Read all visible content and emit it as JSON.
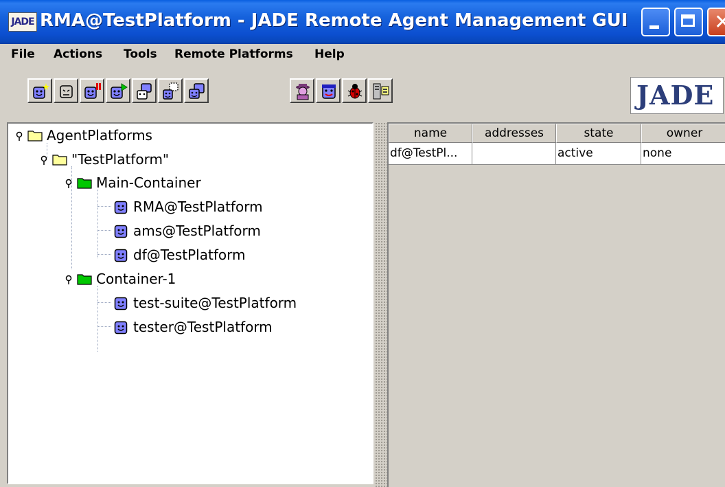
{
  "window": {
    "title": "RMA@TestPlatform - JADE Remote Agent Management GUI",
    "app_icon_text": "JADE",
    "controls": [
      "minimize-icon",
      "maximize-icon",
      "close-icon"
    ]
  },
  "menu": {
    "file": "File",
    "actions": "Actions",
    "tools": "Tools",
    "remote_platforms": "Remote Platforms",
    "help": "Help"
  },
  "toolbar": {
    "buttons": [
      {
        "icon": "new-agent-icon"
      },
      {
        "icon": "kill-agent-icon"
      },
      {
        "icon": "suspend-agent-icon"
      },
      {
        "icon": "resume-agent-icon"
      },
      {
        "icon": "send-message-icon"
      },
      {
        "icon": "migrate-agent-icon"
      },
      {
        "icon": "clone-agent-icon"
      },
      {
        "icon": "sniffer-icon"
      },
      {
        "icon": "dummy-agent-icon"
      },
      {
        "icon": "introspector-icon"
      },
      {
        "icon": "log-manager-icon"
      }
    ],
    "logo_text": "JADE"
  },
  "tree": {
    "root": "AgentPlatforms",
    "platform": "\"TestPlatform\"",
    "containers": [
      {
        "name": "Main-Container",
        "agents": [
          "RMA@TestPlatform",
          "ams@TestPlatform",
          "df@TestPlatform"
        ]
      },
      {
        "name": "Container-1",
        "agents": [
          "test-suite@TestPlatform",
          "tester@TestPlatform"
        ]
      }
    ]
  },
  "table": {
    "columns": [
      "name",
      "addresses",
      "state",
      "owner"
    ],
    "rows": [
      [
        "df@TestPl...",
        "",
        "active",
        "none"
      ]
    ]
  },
  "colors": {
    "titlebar": "#1662dc",
    "container_folder": "#00c800",
    "platform_folder": "#ffff9c",
    "window_bg": "#d4d0c8"
  }
}
